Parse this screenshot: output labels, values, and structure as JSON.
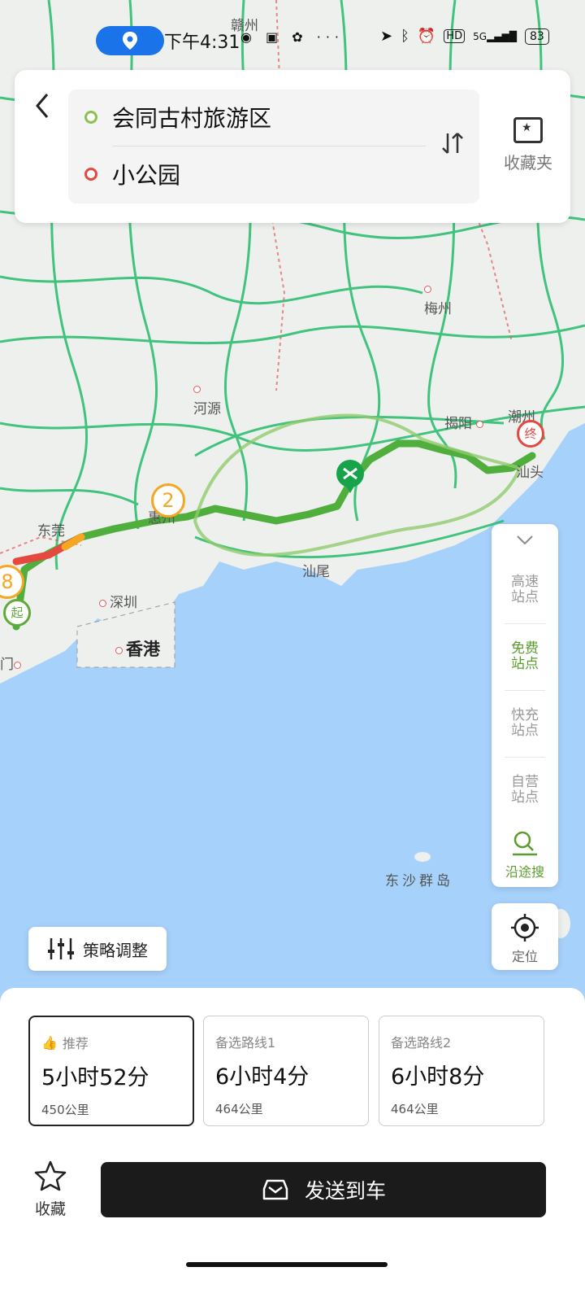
{
  "status_bar": {
    "time": "下午4:31",
    "network": "5G",
    "battery": "83"
  },
  "route_search": {
    "origin": "会同古村旅游区",
    "destination": "小公园",
    "favorites_label": "收藏夹"
  },
  "map": {
    "cities": [
      "赣州",
      "梅州",
      "河源",
      "揭阳",
      "潮州",
      "汕头",
      "惠州",
      "东莞",
      "深圳",
      "香港",
      "汕尾",
      "东沙群岛",
      "门"
    ],
    "route_markers": {
      "start": "起",
      "end": "终",
      "waypoint_a": "2",
      "waypoint_b": "8"
    }
  },
  "side_panel": {
    "items": [
      "高速站点",
      "免费站点",
      "快充站点",
      "自营站点"
    ],
    "active_item": "免费站点",
    "along_search_label": "沿途搜"
  },
  "locate_label": "定位",
  "strategy_label": "策略调整",
  "routes": [
    {
      "tag": "推荐",
      "time": "5小时52分",
      "distance": "450公里",
      "selected": true
    },
    {
      "tag": "备选路线1",
      "time": "6小时4分",
      "distance": "464公里",
      "selected": false
    },
    {
      "tag": "备选路线2",
      "time": "6小时8分",
      "distance": "464公里",
      "selected": false
    }
  ],
  "bottom_actions": {
    "favorite_label": "收藏",
    "send_to_car_label": "发送到车"
  },
  "colors": {
    "route_green": "#4fae3c",
    "map_water": "#a6d1fb",
    "map_land": "#eef0ee",
    "highway_green": "#2fbf71",
    "end_marker": "#e5483f",
    "start_marker": "#5faa3a",
    "waypoint_orange": "#f5a623"
  }
}
